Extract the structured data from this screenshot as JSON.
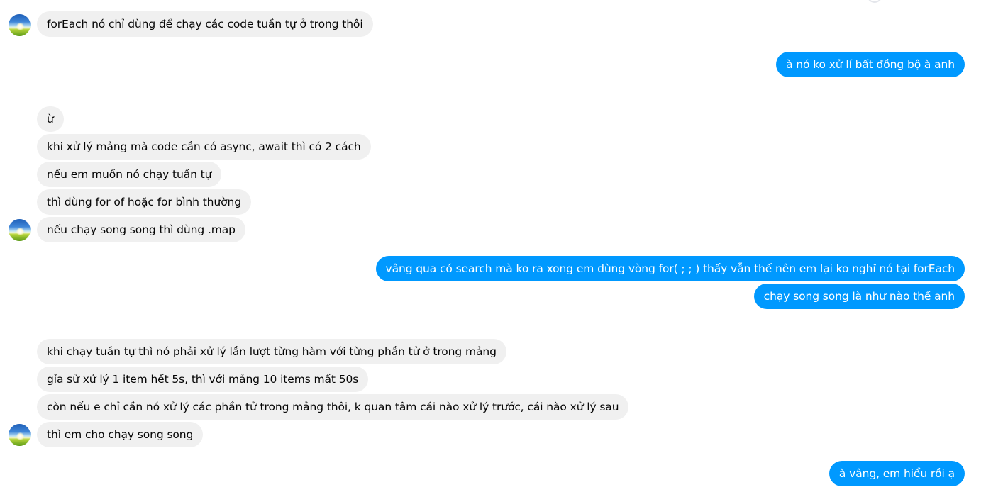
{
  "messages": [
    {
      "side": "in",
      "text": "forEach nó chỉ dùng để chạy các code tuần tự ở trong thôi"
    },
    {
      "side": "out",
      "text": "à nó ko xử lí bất đồng bộ à anh"
    },
    {
      "side": "in",
      "text": "ừ"
    },
    {
      "side": "in",
      "text": "khi xử lý mảng mà code cần có async, await thì có 2 cách"
    },
    {
      "side": "in",
      "text": "nếu em muốn nó chạy tuần tự"
    },
    {
      "side": "in",
      "text": "thì dùng for of hoặc for bình thường"
    },
    {
      "side": "in",
      "text": "nếu chạy song song thì dùng .map"
    },
    {
      "side": "out",
      "text": "vâng qua có search mà ko ra xong em dùng vòng for( ; ; ) thấy vẫn thế nên em lại ko nghĩ nó tại forEach"
    },
    {
      "side": "out",
      "text": "chạy song song là như nào thế anh"
    },
    {
      "side": "in",
      "text": "khi chạy tuần tự thì nó phải xử lý lần lượt từng hàm với từng phần tử ở trong mảng"
    },
    {
      "side": "in",
      "text": "gỉa sử xử lý 1 item hết 5s, thì với mảng 10 items mất 50s"
    },
    {
      "side": "in",
      "text": "còn nếu e chỉ cần nó xử lý các phần tử trong mảng thôi, k quan tâm cái nào xử lý trước, cái nào xử lý sau"
    },
    {
      "side": "in",
      "text": "thì em cho chạy song song"
    },
    {
      "side": "out",
      "text": "à vâng, em hiểu rồi ạ"
    }
  ],
  "colors": {
    "incoming_bubble": "#f0f0f0",
    "outgoing_bubble": "#0099ff"
  },
  "icons": {
    "avatar": "contact-avatar-landscape",
    "seen": "seen-indicator-icon"
  }
}
